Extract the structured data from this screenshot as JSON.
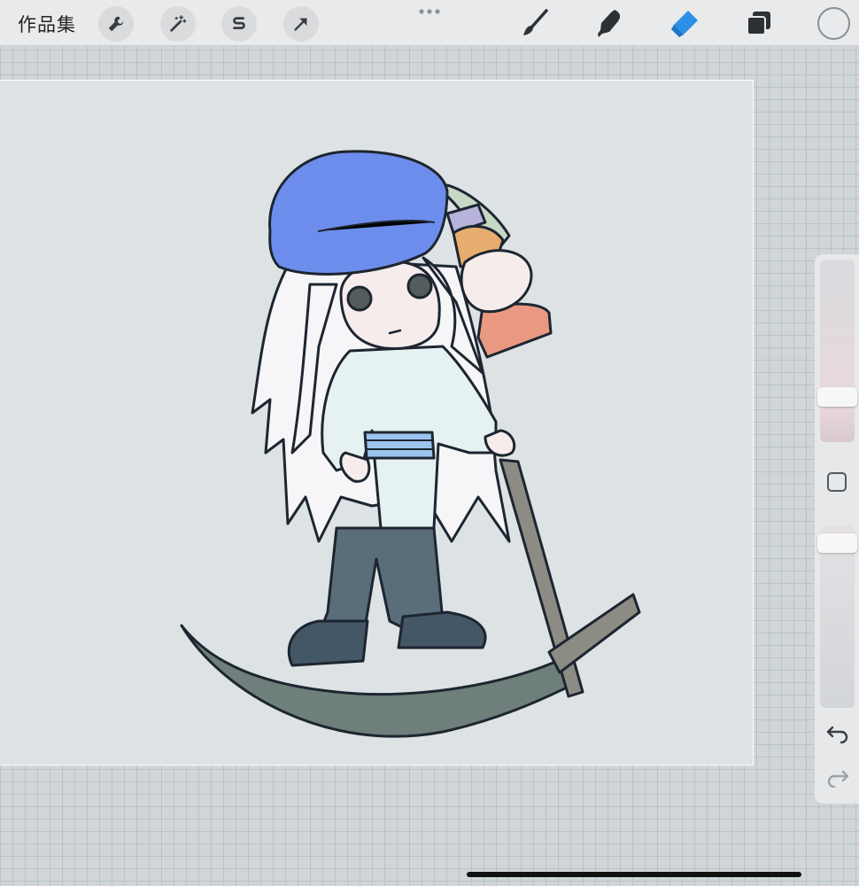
{
  "toolbar": {
    "gallery_label": "作品集",
    "left_tools": [
      {
        "name": "actions",
        "icon": "wrench-icon"
      },
      {
        "name": "adjustments",
        "icon": "magic-wand-icon"
      },
      {
        "name": "selection",
        "icon": "selection-s-icon"
      },
      {
        "name": "transform",
        "icon": "arrow-icon"
      }
    ],
    "more_icon": "ellipsis-icon",
    "right_tools": [
      {
        "name": "brush",
        "icon": "paintbrush-icon"
      },
      {
        "name": "smudge",
        "icon": "smudge-icon"
      },
      {
        "name": "eraser",
        "icon": "eraser-icon",
        "active": true
      },
      {
        "name": "layers",
        "icon": "layers-icon"
      }
    ],
    "active_color": "#2c8fe6",
    "current_color": "#e8eaec"
  },
  "sidebar": {
    "size_level": 0.22,
    "opacity_level": 0.95,
    "modify_icon": "square-icon",
    "undo_icon": "undo-icon",
    "redo_icon": "redo-icon"
  },
  "palette": {
    "hat": "#6d8ded",
    "hair": "#f6f5f8",
    "shirt": "#e6f1f2",
    "sash": "#9bc4ef",
    "pants": "#5a6d7b",
    "boots": "#445766",
    "scythe_blade": "#6f7f7b",
    "scythe_pole": "#8d8c84",
    "skin": "#f7ecec"
  }
}
